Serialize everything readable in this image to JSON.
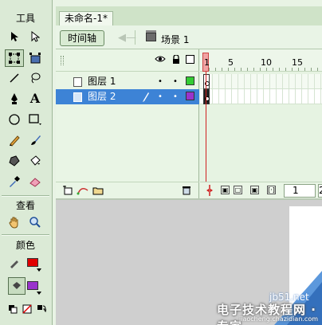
{
  "tools": {
    "title": "工具",
    "view_title": "查看",
    "colors_title": "颜色"
  },
  "document": {
    "tab_title": "未命名-1*"
  },
  "editbar": {
    "timeline_button": "时间轴",
    "scene_label": "场景 1"
  },
  "timeline": {
    "ruler_labels": [
      "1",
      "5",
      "10",
      "15"
    ],
    "layers": [
      {
        "name": "图层 1",
        "color": "#33cc33",
        "selected": false
      },
      {
        "name": "图层 2",
        "color": "#9933cc",
        "selected": true
      }
    ],
    "current_frame": "1",
    "fps_partial": "2"
  },
  "colors": {
    "stroke": "#e00000",
    "fill": "#9933cc"
  },
  "watermark": {
    "url": "jb51.net",
    "text": "电子技术教程网 · 专家",
    "sub": "jiaocheng.chazidian.com"
  }
}
